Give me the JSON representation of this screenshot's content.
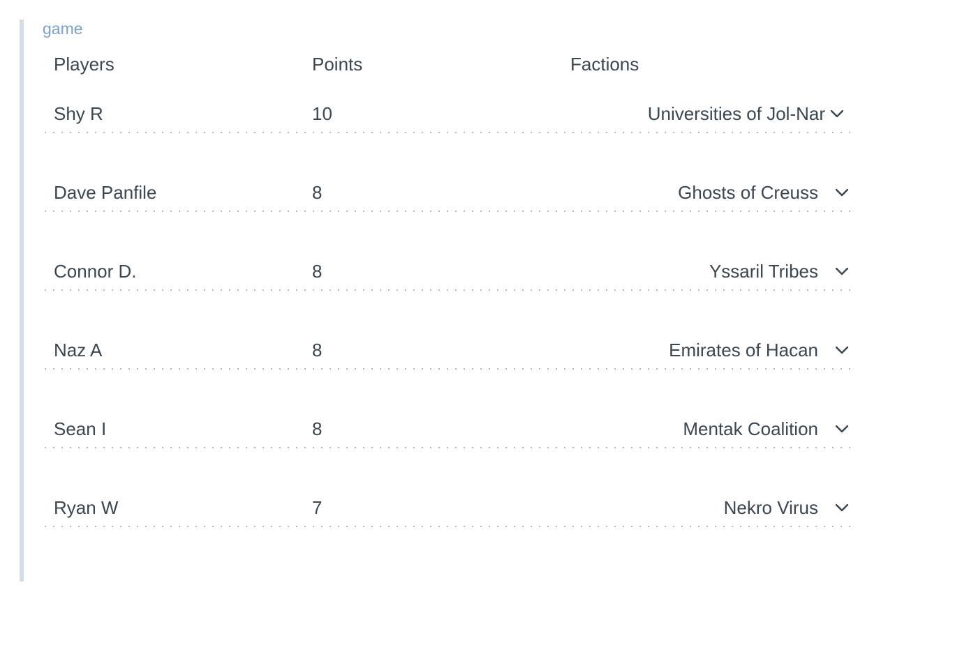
{
  "tag": "game",
  "headers": {
    "players": "Players",
    "points": "Points",
    "factions": "Factions"
  },
  "rows": [
    {
      "player": "Shy R",
      "points": "10",
      "faction": "Universities of Jol-Nar"
    },
    {
      "player": "Dave Panfile",
      "points": "8",
      "faction": "Ghosts of Creuss"
    },
    {
      "player": "Connor D.",
      "points": "8",
      "faction": "Yssaril Tribes"
    },
    {
      "player": "Naz A",
      "points": "8",
      "faction": "Emirates of Hacan"
    },
    {
      "player": "Sean I",
      "points": "8",
      "faction": "Mentak Coalition"
    },
    {
      "player": "Ryan W",
      "points": "7",
      "faction": "Nekro Virus"
    }
  ]
}
